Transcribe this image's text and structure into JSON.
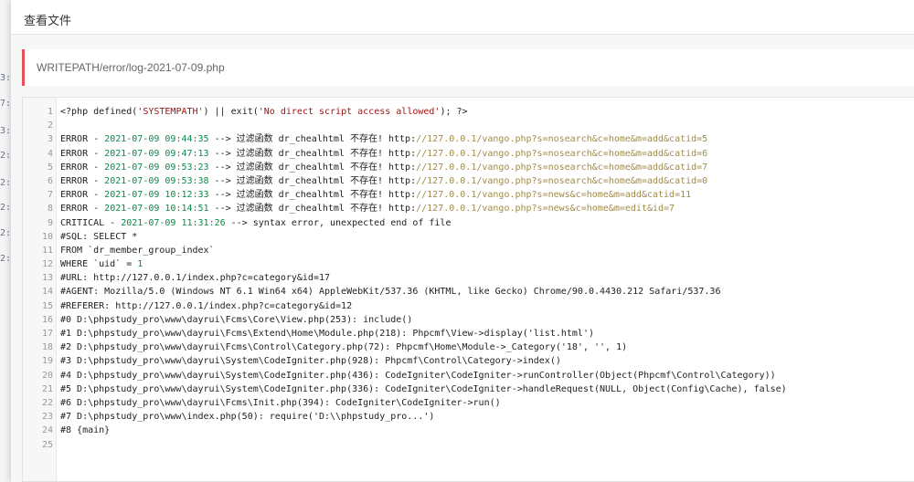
{
  "modal": {
    "title": "查看文件",
    "path": "WRITEPATH/error/log-2021-07-09.php"
  },
  "background": {
    "fragments": [
      "3:",
      "7:",
      "3:",
      "2:",
      "2:",
      "2:",
      "2:",
      "2:"
    ]
  },
  "colors": {
    "accent": "#e7505a",
    "date": "#0a8a4a",
    "url": "#a08b4c",
    "string": "#a31515"
  },
  "code_lines": [
    {
      "n": "1",
      "segs": [
        {
          "t": "<?php defined("
        },
        {
          "t": "'SYSTEMPATH'",
          "c": "str"
        },
        {
          "t": ") || exit("
        },
        {
          "t": "'No direct script access allowed'",
          "c": "str"
        },
        {
          "t": "); ?>"
        }
      ]
    },
    {
      "n": "2",
      "segs": []
    },
    {
      "n": "3",
      "segs": [
        {
          "t": "ERROR - "
        },
        {
          "t": "2021-07-09 09:44:35",
          "c": "date"
        },
        {
          "t": " --> 过滤函数 dr_chealhtml 不存在! http:"
        },
        {
          "t": "//127.0.0.1/vango.php?s=nosearch&c=home&m=add&catid=5",
          "c": "url"
        }
      ]
    },
    {
      "n": "4",
      "segs": [
        {
          "t": "ERROR - "
        },
        {
          "t": "2021-07-09 09:47:13",
          "c": "date"
        },
        {
          "t": " --> 过滤函数 dr_chealhtml 不存在! http:"
        },
        {
          "t": "//127.0.0.1/vango.php?s=nosearch&c=home&m=add&catid=6",
          "c": "url"
        }
      ]
    },
    {
      "n": "5",
      "segs": [
        {
          "t": "ERROR - "
        },
        {
          "t": "2021-07-09 09:53:23",
          "c": "date"
        },
        {
          "t": " --> 过滤函数 dr_chealhtml 不存在! http:"
        },
        {
          "t": "//127.0.0.1/vango.php?s=nosearch&c=home&m=add&catid=7",
          "c": "url"
        }
      ]
    },
    {
      "n": "6",
      "segs": [
        {
          "t": "ERROR - "
        },
        {
          "t": "2021-07-09 09:53:38",
          "c": "date"
        },
        {
          "t": " --> 过滤函数 dr_chealhtml 不存在! http:"
        },
        {
          "t": "//127.0.0.1/vango.php?s=nosearch&c=home&m=add&catid=0",
          "c": "url"
        }
      ]
    },
    {
      "n": "7",
      "segs": [
        {
          "t": "ERROR - "
        },
        {
          "t": "2021-07-09 10:12:33",
          "c": "date"
        },
        {
          "t": " --> 过滤函数 dr_chealhtml 不存在! http:"
        },
        {
          "t": "//127.0.0.1/vango.php?s=news&c=home&m=add&catid=11",
          "c": "url"
        }
      ]
    },
    {
      "n": "8",
      "segs": [
        {
          "t": "ERROR - "
        },
        {
          "t": "2021-07-09 10:14:51",
          "c": "date"
        },
        {
          "t": " --> 过滤函数 dr_chealhtml 不存在! http:"
        },
        {
          "t": "//127.0.0.1/vango.php?s=news&c=home&m=edit&id=7",
          "c": "url"
        }
      ]
    },
    {
      "n": "9",
      "segs": [
        {
          "t": "CRITICAL - "
        },
        {
          "t": "2021-07-09 11:31:26",
          "c": "date"
        },
        {
          "t": " --> syntax error, unexpected end of file"
        }
      ]
    },
    {
      "n": "10",
      "segs": [
        {
          "t": "#SQL: SELECT *"
        }
      ]
    },
    {
      "n": "11",
      "segs": [
        {
          "t": "FROM `dr_member_group_index`"
        }
      ]
    },
    {
      "n": "12",
      "segs": [
        {
          "t": "WHERE `uid` = "
        },
        {
          "t": "1",
          "c": "num"
        }
      ]
    },
    {
      "n": "13",
      "segs": [
        {
          "t": "#URL: http://127.0.0.1/index.php?c=category&id=17"
        }
      ]
    },
    {
      "n": "14",
      "segs": [
        {
          "t": "#AGENT: Mozilla/5.0 (Windows NT 6.1 Win64 x64) AppleWebKit/537.36 (KHTML, like Gecko) Chrome/90.0.4430.212 Safari/537.36"
        }
      ]
    },
    {
      "n": "15",
      "segs": [
        {
          "t": "#REFERER: http://127.0.0.1/index.php?c=category&id=12"
        }
      ]
    },
    {
      "n": "16",
      "segs": [
        {
          "t": "#0 D:\\phpstudy_pro\\www\\dayrui\\Fcms\\Core\\View.php(253): include()"
        }
      ]
    },
    {
      "n": "17",
      "segs": [
        {
          "t": "#1 D:\\phpstudy_pro\\www\\dayrui\\Fcms\\Extend\\Home\\Module.php(218): Phpcmf\\View->display('list.html')"
        }
      ]
    },
    {
      "n": "18",
      "segs": [
        {
          "t": "#2 D:\\phpstudy_pro\\www\\dayrui\\Fcms\\Control\\Category.php(72): Phpcmf\\Home\\Module->_Category('18', '', 1)"
        }
      ]
    },
    {
      "n": "19",
      "segs": [
        {
          "t": "#3 D:\\phpstudy_pro\\www\\dayrui\\System\\CodeIgniter.php(928): Phpcmf\\Control\\Category->index()"
        }
      ]
    },
    {
      "n": "20",
      "segs": [
        {
          "t": "#4 D:\\phpstudy_pro\\www\\dayrui\\System\\CodeIgniter.php(436): CodeIgniter\\CodeIgniter->runController(Object(Phpcmf\\Control\\Category))"
        }
      ]
    },
    {
      "n": "21",
      "segs": [
        {
          "t": "#5 D:\\phpstudy_pro\\www\\dayrui\\System\\CodeIgniter.php(336): CodeIgniter\\CodeIgniter->handleRequest(NULL, Object(Config\\Cache), false)"
        }
      ]
    },
    {
      "n": "22",
      "segs": [
        {
          "t": "#6 D:\\phpstudy_pro\\www\\dayrui\\Fcms\\Init.php(394): CodeIgniter\\CodeIgniter->run()"
        }
      ]
    },
    {
      "n": "23",
      "segs": [
        {
          "t": "#7 D:\\phpstudy_pro\\www\\index.php(50): require('D:\\\\phpstudy_pro...')"
        }
      ]
    },
    {
      "n": "24",
      "segs": [
        {
          "t": "#8 {main}"
        }
      ]
    },
    {
      "n": "25",
      "segs": []
    }
  ]
}
